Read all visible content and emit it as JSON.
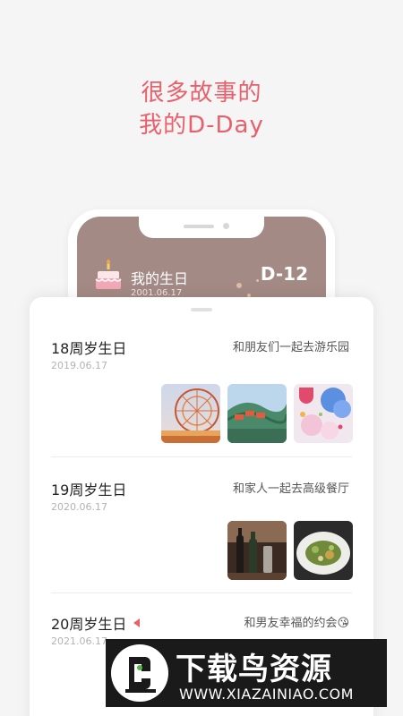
{
  "headline": {
    "line1": "很多故事的",
    "line2": "我的D-Day"
  },
  "phone_preview": {
    "title": "我的生日",
    "date": "2001.06.17",
    "dday": "D-12",
    "icon": "birthday-cake-icon"
  },
  "entries": [
    {
      "title": "18周岁生日",
      "date": "2019.06.17",
      "description": "和朋友们一起去游乐园",
      "photos": [
        "ferris-wheel-photo",
        "roller-coaster-photo",
        "balloons-photo"
      ]
    },
    {
      "title": "19周岁生日",
      "date": "2020.06.17",
      "description": "和家人一起去高级餐厅",
      "photos": [
        "wine-bottles-photo",
        "salad-dish-photo"
      ]
    },
    {
      "title": "20周岁生日",
      "date": "2021.06.17",
      "description": "和男友幸福的约会😘",
      "photos": []
    }
  ],
  "watermark": {
    "brand": "下载鸟资源",
    "url": "WWW.XIAZAINIAO.COM"
  },
  "colors": {
    "accent": "#e8606b",
    "phone_screen": "#a48a84",
    "background": "#f6f5f5"
  }
}
